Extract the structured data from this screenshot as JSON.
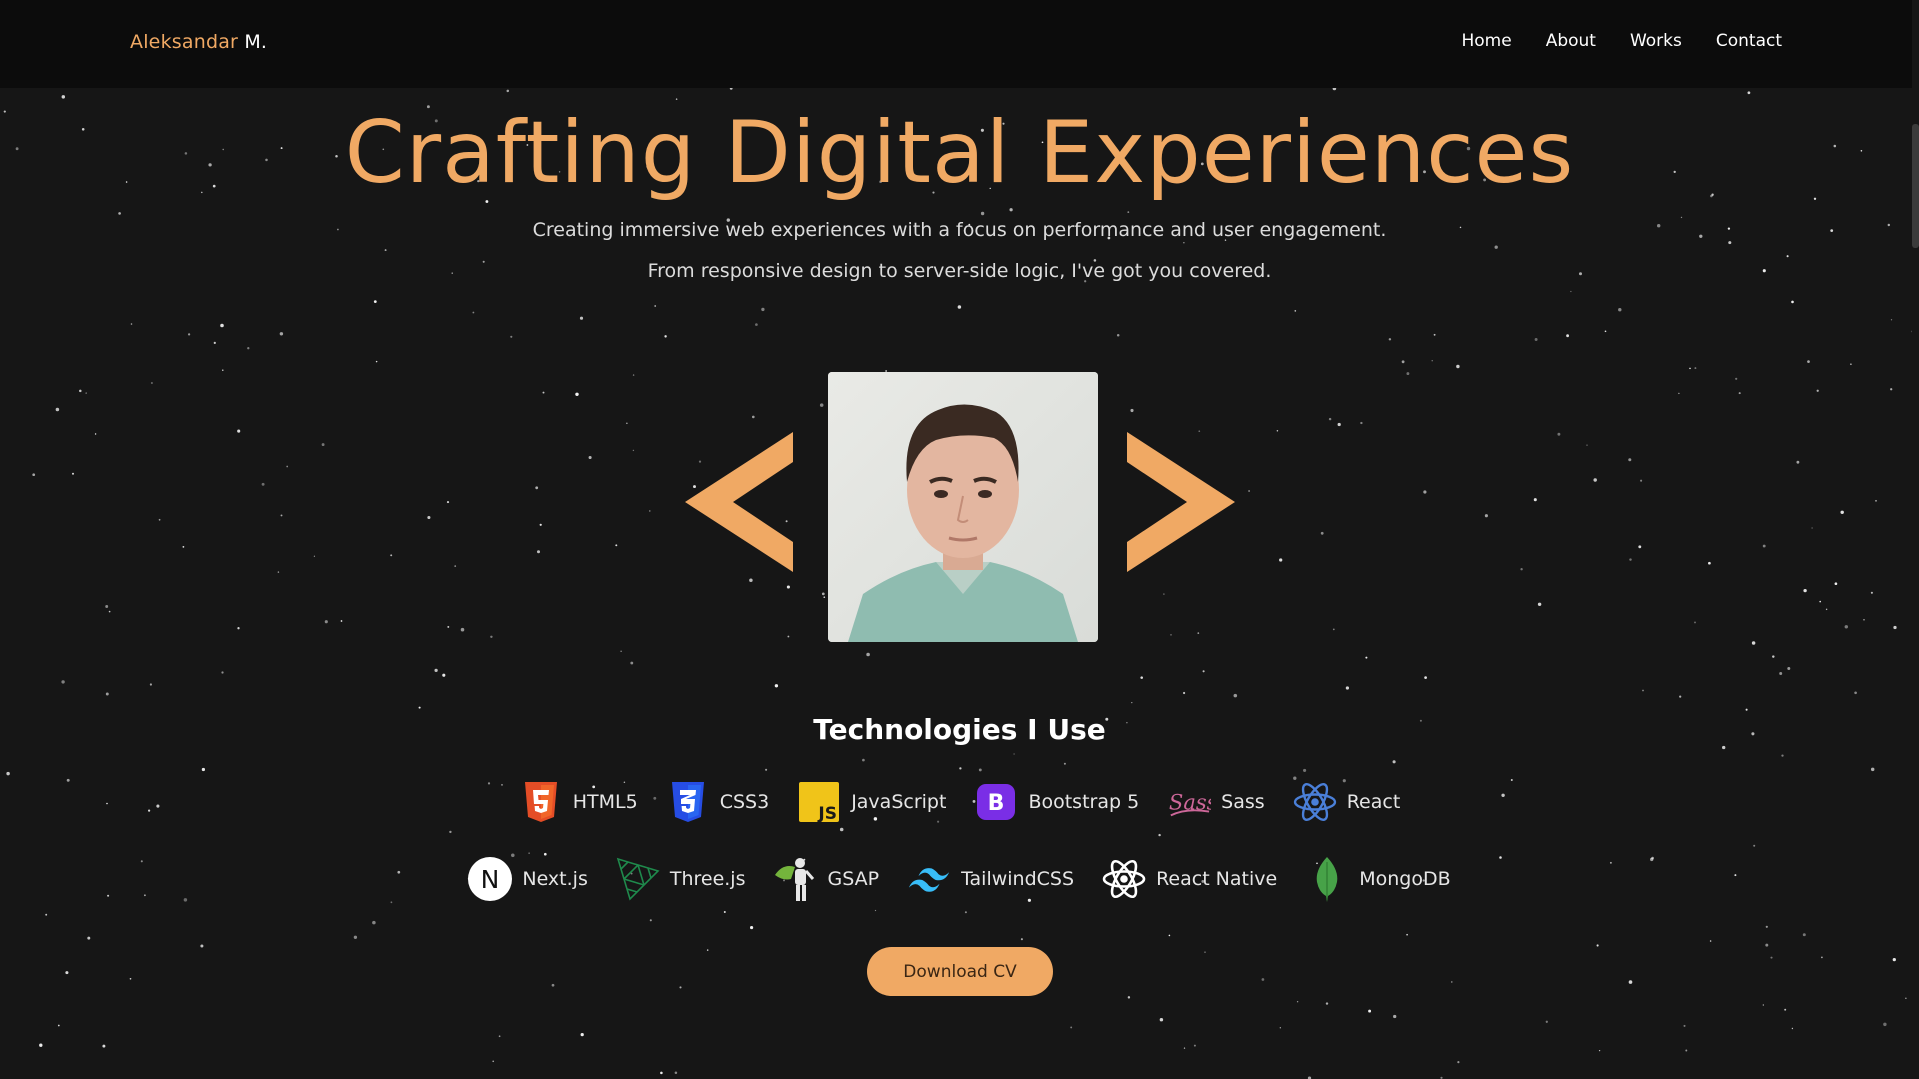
{
  "nav": {
    "brand_first": "Aleksandar",
    "brand_last": "M.",
    "links": [
      "Home",
      "About",
      "Works",
      "Contact"
    ]
  },
  "hero": {
    "title": "Crafting Digital Experiences",
    "subtitle_1": "Creating immersive web experiences with a focus on performance and user engagement.",
    "subtitle_2": "From responsive design to server-side logic, I've got you covered."
  },
  "tech": {
    "heading": "Technologies I Use",
    "row1": [
      {
        "label": "HTML5",
        "icon": "html5-icon"
      },
      {
        "label": "CSS3",
        "icon": "css3-icon"
      },
      {
        "label": "JavaScript",
        "icon": "javascript-icon"
      },
      {
        "label": "Bootstrap 5",
        "icon": "bootstrap-icon"
      },
      {
        "label": "Sass",
        "icon": "sass-icon"
      },
      {
        "label": "React",
        "icon": "react-icon"
      }
    ],
    "row2": [
      {
        "label": "Next.js",
        "icon": "nextjs-icon"
      },
      {
        "label": "Three.js",
        "icon": "threejs-icon"
      },
      {
        "label": "GSAP",
        "icon": "gsap-icon"
      },
      {
        "label": "TailwindCSS",
        "icon": "tailwind-icon"
      },
      {
        "label": "React Native",
        "icon": "react-native-icon"
      },
      {
        "label": "MongoDB",
        "icon": "mongodb-icon"
      }
    ]
  },
  "cta": {
    "download_label": "Download CV"
  },
  "colors": {
    "accent": "#f0a964",
    "background": "#161616",
    "navbar": "#0c0c0c"
  }
}
